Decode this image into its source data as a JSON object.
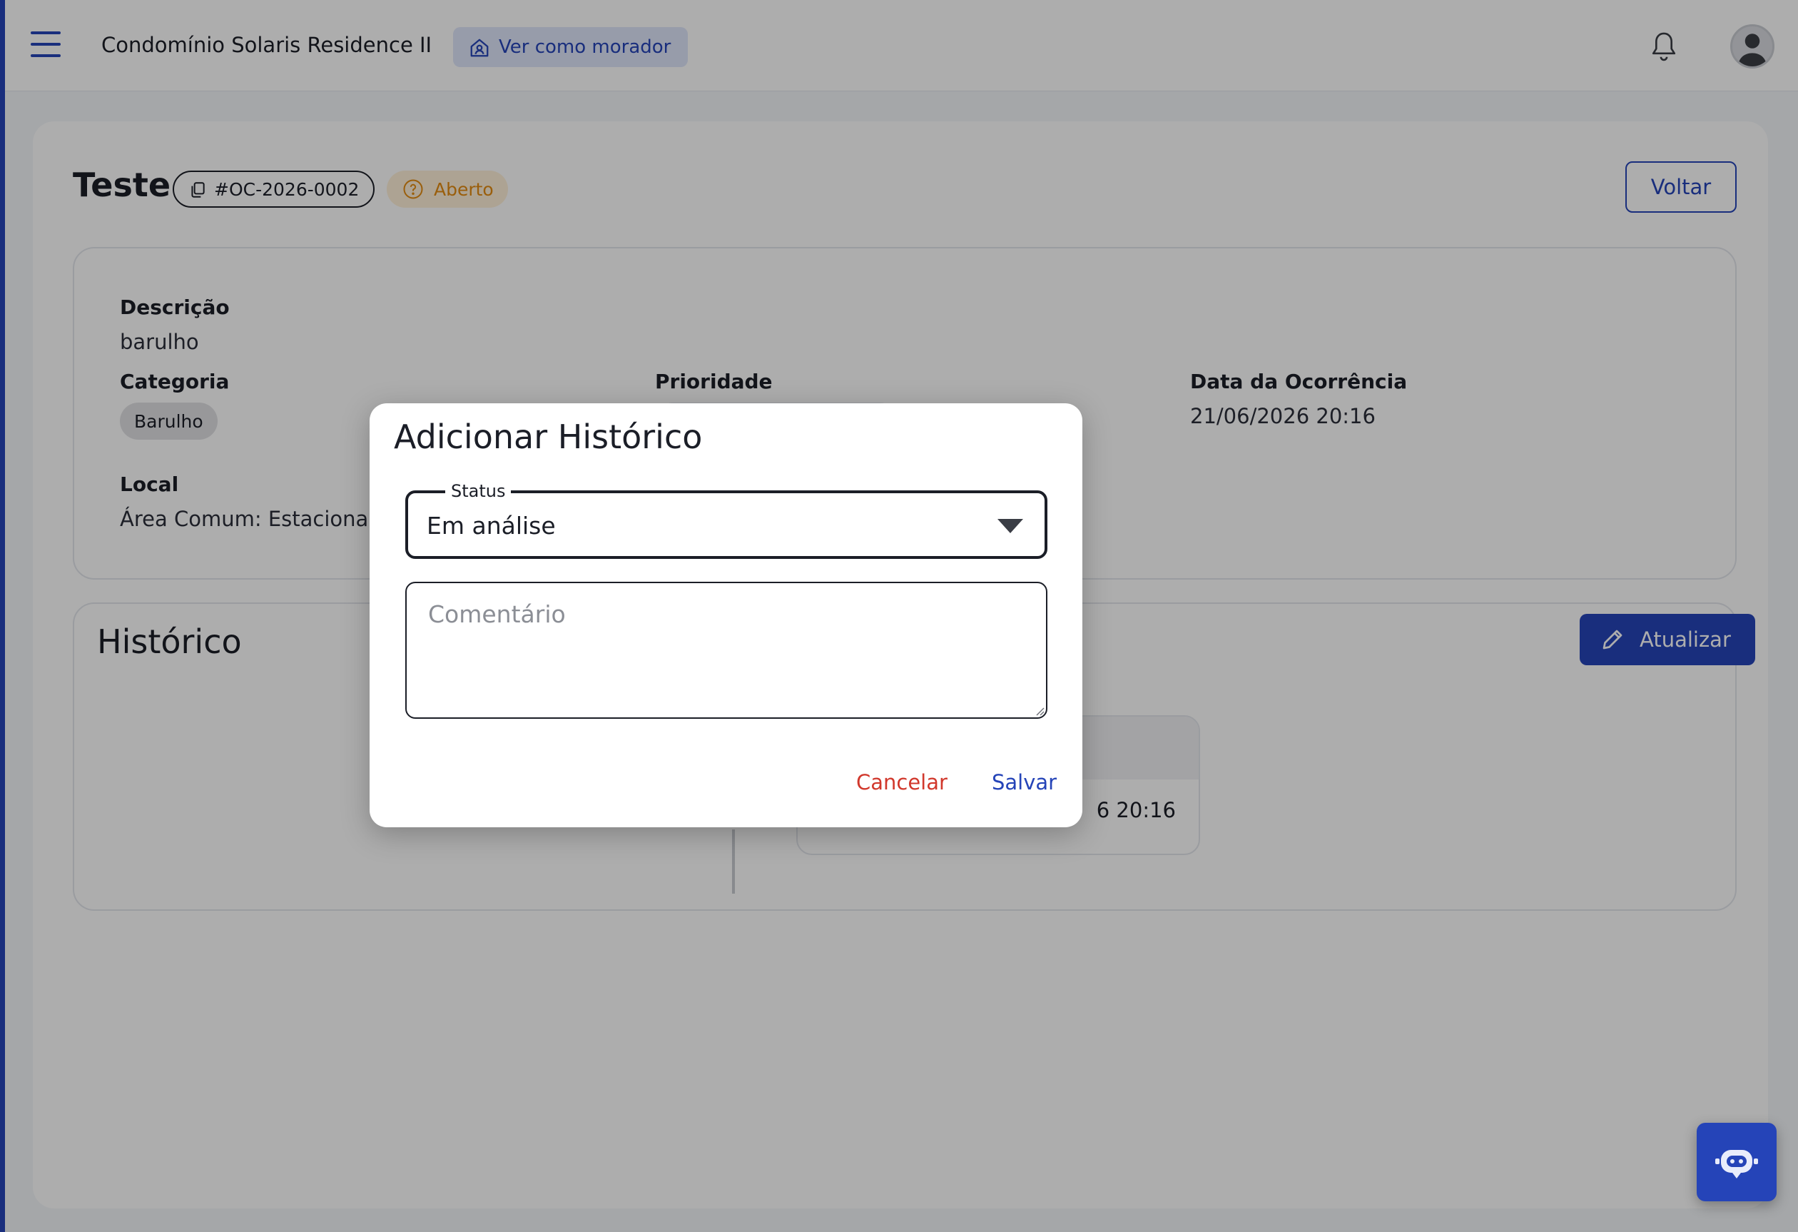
{
  "header": {
    "condo_name": "Condomínio Solaris Residence II",
    "view_as_label": "Ver como morador"
  },
  "occurrence": {
    "title": "Teste",
    "code": "#OC-2026-0002",
    "status": "Aberto",
    "back_label": "Voltar",
    "fields": {
      "description_label": "Descrição",
      "description_value": "barulho",
      "category_label": "Categoria",
      "category_value": "Barulho",
      "priority_label": "Prioridade",
      "date_label": "Data da Ocorrência",
      "date_value": "21/06/2026 20:16",
      "location_label": "Local",
      "location_value": "Área Comum: Estaciona"
    }
  },
  "history": {
    "title": "Histórico",
    "update_label": "Atualizar",
    "entry_date_partial": "6 20:16"
  },
  "modal": {
    "title": "Adicionar Histórico",
    "status_label": "Status",
    "status_value": "Em análise",
    "comment_placeholder": "Comentário",
    "cancel_label": "Cancelar",
    "save_label": "Salvar"
  },
  "icons": {
    "menu": "menu-icon",
    "home": "home-icon",
    "bell": "bell-icon",
    "copy": "copy-icon",
    "question": "question-circle-icon",
    "pencil": "pencil-icon",
    "dropdown": "chevron-down-icon",
    "bot": "bot-icon"
  },
  "colors": {
    "primary": "#2544b8",
    "status_open": "#e38b11",
    "cancel": "#d1382c",
    "overlay": "rgba(0,0,0,0.32)"
  }
}
